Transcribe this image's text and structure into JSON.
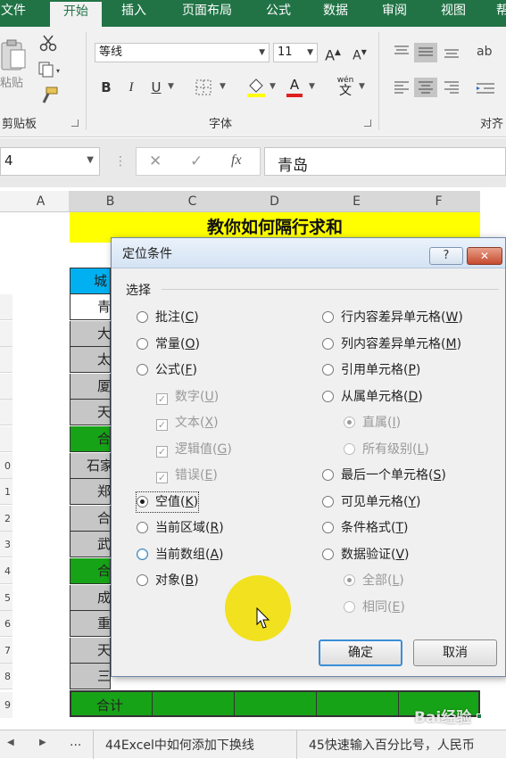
{
  "ribbon": {
    "tabs": [
      {
        "label": "文件",
        "active": false
      },
      {
        "label": "开始",
        "active": true
      },
      {
        "label": "插入",
        "active": false
      },
      {
        "label": "页面布局",
        "active": false
      },
      {
        "label": "公式",
        "active": false
      },
      {
        "label": "数据",
        "active": false
      },
      {
        "label": "审阅",
        "active": false
      },
      {
        "label": "视图",
        "active": false
      },
      {
        "label": "帮",
        "active": false
      }
    ],
    "clipboard": {
      "paste_label": "粘贴",
      "group_label": "剪贴板"
    },
    "font": {
      "font_name": "等线",
      "font_size": "11",
      "grow_label": "A",
      "shrink_label": "A",
      "bold": "B",
      "italic": "I",
      "underline": "U",
      "font_color": "A",
      "phonetic": "wén",
      "phonetic_char": "文",
      "group_label": "字体"
    },
    "alignment": {
      "group_label": "对齐"
    }
  },
  "formula_bar": {
    "name_box": "4",
    "cancel": "✕",
    "enter": "✓",
    "fx": "fx",
    "value": "青岛"
  },
  "sheet": {
    "columns": [
      "A",
      "B",
      "C",
      "D",
      "E",
      "F"
    ],
    "title": "教你如何隔行求和",
    "header_cell": "城",
    "rows": [
      {
        "num": "",
        "text": "青",
        "fill": "#ffffff"
      },
      {
        "num": "",
        "text": "大",
        "fill": "#c6c6c6"
      },
      {
        "num": "",
        "text": "太",
        "fill": "#c6c6c6"
      },
      {
        "num": "",
        "text": "厦",
        "fill": "#c6c6c6"
      },
      {
        "num": "",
        "text": "天",
        "fill": "#c6c6c6"
      },
      {
        "num": "",
        "text": "合",
        "fill": "#17a317"
      },
      {
        "num": "0",
        "text": "石家",
        "fill": "#c6c6c6"
      },
      {
        "num": "1",
        "text": "郑",
        "fill": "#c6c6c6"
      },
      {
        "num": "2",
        "text": "合",
        "fill": "#c6c6c6"
      },
      {
        "num": "3",
        "text": "武",
        "fill": "#c6c6c6"
      },
      {
        "num": "4",
        "text": "合",
        "fill": "#17a317"
      },
      {
        "num": "5",
        "text": "成",
        "fill": "#c6c6c6"
      },
      {
        "num": "6",
        "text": "重",
        "fill": "#c6c6c6"
      },
      {
        "num": "7",
        "text": "天",
        "fill": "#c6c6c6"
      },
      {
        "num": "8",
        "text": "三",
        "fill": "#c6c6c6"
      }
    ],
    "total_row": {
      "num": "9",
      "label": "合计"
    }
  },
  "status_bar": {
    "nav_prev": "◀",
    "nav_next": "▶",
    "more": "...",
    "sheet_tabs": [
      "44Excel中如何添加下换线",
      "45快速输入百分比号，人民币"
    ]
  },
  "dialog": {
    "title": "定位条件",
    "help": "?",
    "close": "✕",
    "section_label": "选择",
    "left_options": [
      {
        "label": "批注",
        "key": "C",
        "kind": "radio",
        "checked": false,
        "disabled": false
      },
      {
        "label": "常量",
        "key": "O",
        "kind": "radio",
        "checked": false,
        "disabled": false
      },
      {
        "label": "公式",
        "key": "F",
        "kind": "radio",
        "checked": false,
        "disabled": false
      },
      {
        "label": "数字",
        "key": "U",
        "kind": "check",
        "checked": true,
        "disabled": true
      },
      {
        "label": "文本",
        "key": "X",
        "kind": "check",
        "checked": true,
        "disabled": true
      },
      {
        "label": "逻辑值",
        "key": "G",
        "kind": "check",
        "checked": true,
        "disabled": true
      },
      {
        "label": "错误",
        "key": "E",
        "kind": "check",
        "checked": true,
        "disabled": true
      },
      {
        "label": "空值",
        "key": "K",
        "kind": "radio",
        "checked": true,
        "disabled": false
      },
      {
        "label": "当前区域",
        "key": "R",
        "kind": "radio",
        "checked": false,
        "disabled": false
      },
      {
        "label": "当前数组",
        "key": "A",
        "kind": "radio",
        "checked": false,
        "disabled": false
      },
      {
        "label": "对象",
        "key": "B",
        "kind": "radio",
        "checked": false,
        "disabled": false
      }
    ],
    "right_options": [
      {
        "label": "行内容差异单元格",
        "key": "W",
        "kind": "radio",
        "checked": false,
        "disabled": false
      },
      {
        "label": "列内容差异单元格",
        "key": "M",
        "kind": "radio",
        "checked": false,
        "disabled": false
      },
      {
        "label": "引用单元格",
        "key": "P",
        "kind": "radio",
        "checked": false,
        "disabled": false
      },
      {
        "label": "从属单元格",
        "key": "D",
        "kind": "radio",
        "checked": false,
        "disabled": false
      },
      {
        "label": "直属",
        "key": "I",
        "kind": "radio",
        "checked": true,
        "disabled": true
      },
      {
        "label": "所有级别",
        "key": "L",
        "kind": "radio",
        "checked": false,
        "disabled": true
      },
      {
        "label": "最后一个单元格",
        "key": "S",
        "kind": "radio",
        "checked": false,
        "disabled": false
      },
      {
        "label": "可见单元格",
        "key": "Y",
        "kind": "radio",
        "checked": false,
        "disabled": false
      },
      {
        "label": "条件格式",
        "key": "T",
        "kind": "radio",
        "checked": false,
        "disabled": false
      },
      {
        "label": "数据验证",
        "key": "V",
        "kind": "radio",
        "checked": false,
        "disabled": false
      },
      {
        "label": "全部",
        "key": "L",
        "kind": "radio",
        "checked": true,
        "disabled": true
      },
      {
        "label": "相同",
        "key": "E",
        "kind": "radio",
        "checked": false,
        "disabled": true
      }
    ],
    "ok_label": "确定",
    "cancel_label": "取消"
  },
  "watermark": {
    "text": "Bai经验"
  },
  "colors": {
    "ribbon_green": "#217346",
    "title_yellow": "#ffff00",
    "total_green": "#17a317",
    "header_blue": "#00b0f0",
    "highlight_yellow": "#f0e000"
  }
}
